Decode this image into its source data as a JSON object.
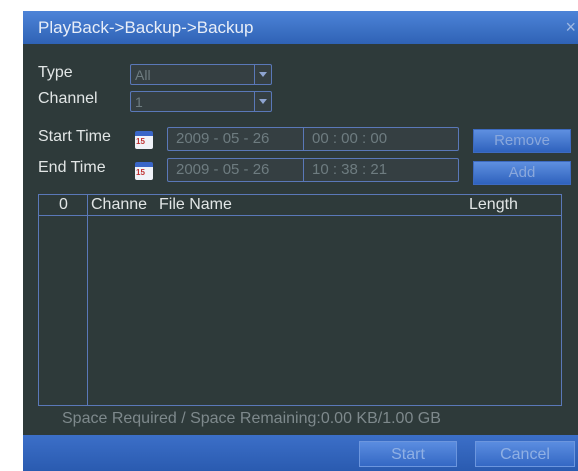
{
  "title": "PlayBack->Backup->Backup",
  "close_glyph": "×",
  "form": {
    "type_label": "Type",
    "type_value": "All",
    "channel_label": "Channel",
    "channel_value": "1",
    "start_label": "Start Time",
    "start_date": "2009 - 05 - 26",
    "start_time": "00 : 00 : 00",
    "end_label": "End Time",
    "end_date": "2009 - 05 - 26",
    "end_time": "10 : 38 : 21",
    "calendar_day": "15"
  },
  "buttons": {
    "remove": "Remove",
    "add": "Add",
    "start": "Start",
    "cancel": "Cancel"
  },
  "table": {
    "col_index": "0",
    "col_channel": "Channe",
    "col_file": "File Name",
    "col_length": "Length"
  },
  "status": "Space Required / Space Remaining:0.00 KB/1.00 GB"
}
